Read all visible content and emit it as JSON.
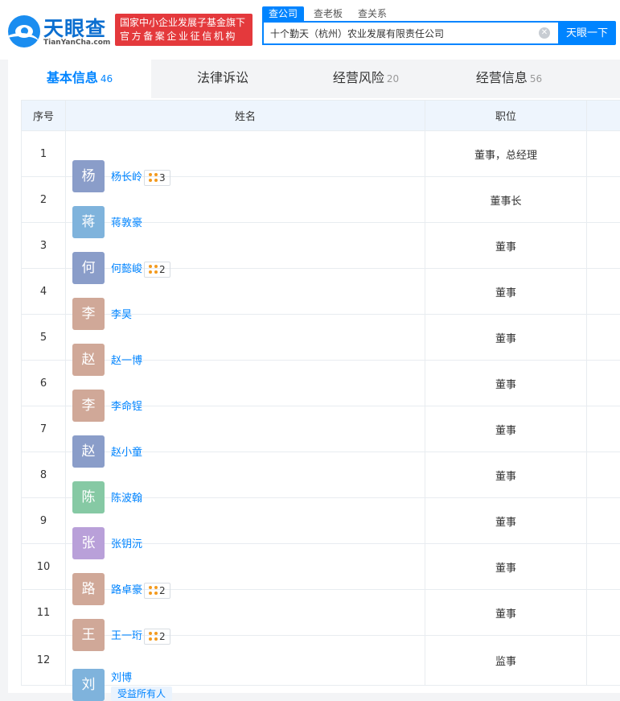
{
  "header": {
    "logo_name": "天眼查",
    "logo_sub": "TianYanCha.com",
    "badge_line1": "国家中小企业发展子基金旗下",
    "badge_line2": "官方备案企业征信机构",
    "search_tabs": [
      "查公司",
      "查老板",
      "查关系"
    ],
    "search_value": "十个勤天（杭州）农业发展有限责任公司",
    "search_button": "天眼一下",
    "brand_color": "#0084ff"
  },
  "tabs": [
    {
      "label": "基本信息",
      "count": "46"
    },
    {
      "label": "法律诉讼",
      "count": ""
    },
    {
      "label": "经营风险",
      "count": "20"
    },
    {
      "label": "经营信息",
      "count": "56"
    }
  ],
  "table": {
    "headers": [
      "序号",
      "姓名",
      "职位"
    ],
    "rows": [
      {
        "idx": "1",
        "avatar": "杨",
        "avatar_color": "#8a9dc9",
        "name": "杨长岭",
        "rel": "3",
        "position": "董事，总经理"
      },
      {
        "idx": "2",
        "avatar": "蒋",
        "avatar_color": "#7fb3dc",
        "name": "蒋敦豪",
        "rel": "",
        "position": "董事长"
      },
      {
        "idx": "3",
        "avatar": "何",
        "avatar_color": "#8a9dc9",
        "name": "何懿峻",
        "rel": "2",
        "position": "董事"
      },
      {
        "idx": "4",
        "avatar": "李",
        "avatar_color": "#d0a898",
        "name": "李昊",
        "rel": "",
        "position": "董事"
      },
      {
        "idx": "5",
        "avatar": "赵",
        "avatar_color": "#d0a898",
        "name": "赵一博",
        "rel": "",
        "position": "董事"
      },
      {
        "idx": "6",
        "avatar": "李",
        "avatar_color": "#d0a898",
        "name": "李命锃",
        "rel": "",
        "position": "董事"
      },
      {
        "idx": "7",
        "avatar": "赵",
        "avatar_color": "#8a9dc9",
        "name": "赵小童",
        "rel": "",
        "position": "董事"
      },
      {
        "idx": "8",
        "avatar": "陈",
        "avatar_color": "#86c9a4",
        "name": "陈波翰",
        "rel": "",
        "position": "董事"
      },
      {
        "idx": "9",
        "avatar": "张",
        "avatar_color": "#b9a0d9",
        "name": "张钥沅",
        "rel": "",
        "position": "董事"
      },
      {
        "idx": "10",
        "avatar": "路",
        "avatar_color": "#d0a898",
        "name": "路卓豪",
        "rel": "2",
        "position": "董事"
      },
      {
        "idx": "11",
        "avatar": "王",
        "avatar_color": "#d0a898",
        "name": "王一珩",
        "rel": "2",
        "position": "董事"
      },
      {
        "idx": "12",
        "avatar": "刘",
        "avatar_color": "#7fb3dc",
        "name": "刘博",
        "rel": "",
        "tag": "受益所有人",
        "position": "监事"
      }
    ]
  }
}
